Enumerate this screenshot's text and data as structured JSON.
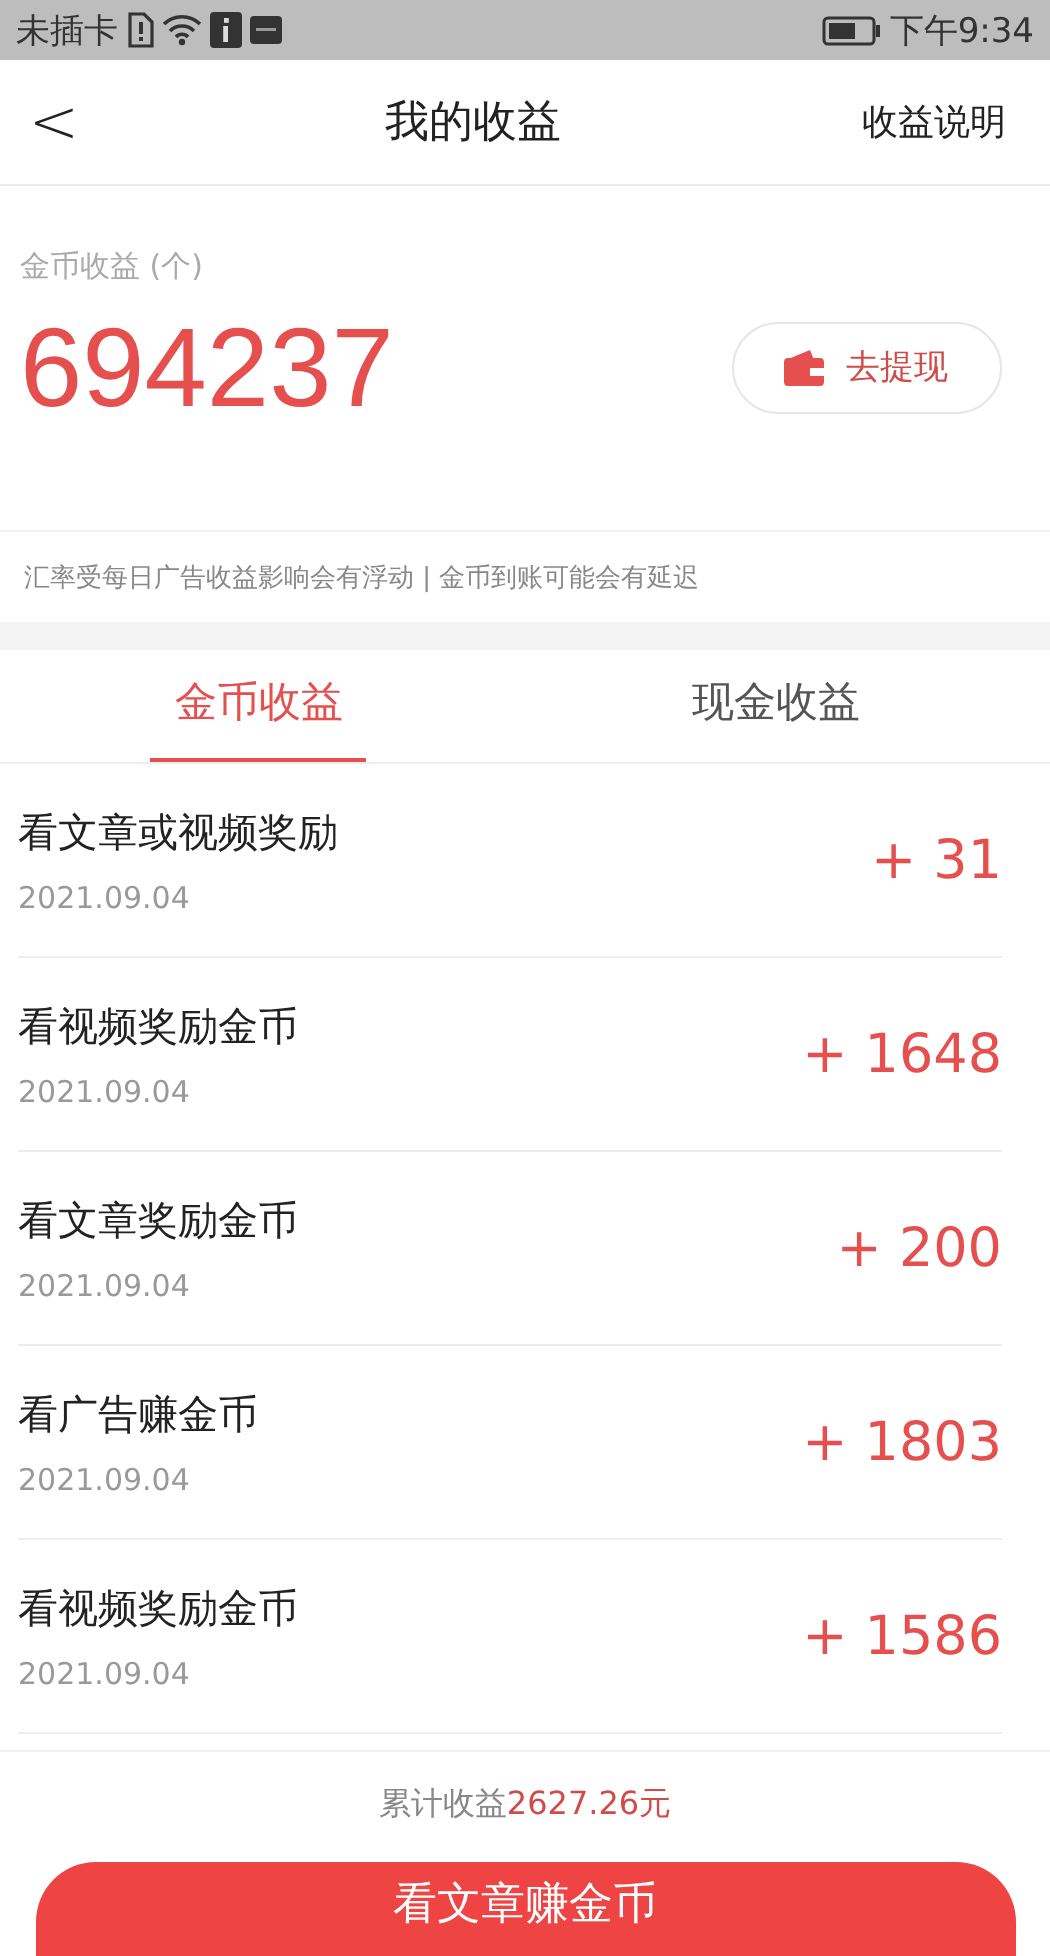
{
  "status_bar": {
    "carrier": "未插卡",
    "time": "下午9:34"
  },
  "nav": {
    "back": "<",
    "title": "我的收益",
    "action": "收益说明"
  },
  "summary": {
    "label": "金币收益 (个)",
    "amount": "694237",
    "withdraw": "去提现"
  },
  "notice": "汇率受每日广告收益影响会有浮动 | 金币到账可能会有延迟",
  "tabs": [
    {
      "label": "金币收益",
      "selected": true
    },
    {
      "label": "现金收益",
      "selected": false
    }
  ],
  "records": [
    {
      "title": "看文章或视频奖励",
      "date": "2021.09.04",
      "amount": "+ 31"
    },
    {
      "title": "看视频奖励金币",
      "date": "2021.09.04",
      "amount": "+ 1648"
    },
    {
      "title": "看文章奖励金币",
      "date": "2021.09.04",
      "amount": "+ 200"
    },
    {
      "title": "看广告赚金币",
      "date": "2021.09.04",
      "amount": "+ 1803"
    },
    {
      "title": "看视频奖励金币",
      "date": "2021.09.04",
      "amount": "+ 1586"
    }
  ],
  "footer": {
    "total_label": "累计收益",
    "total_value": "2627.26元",
    "button": "看文章赚金币"
  }
}
